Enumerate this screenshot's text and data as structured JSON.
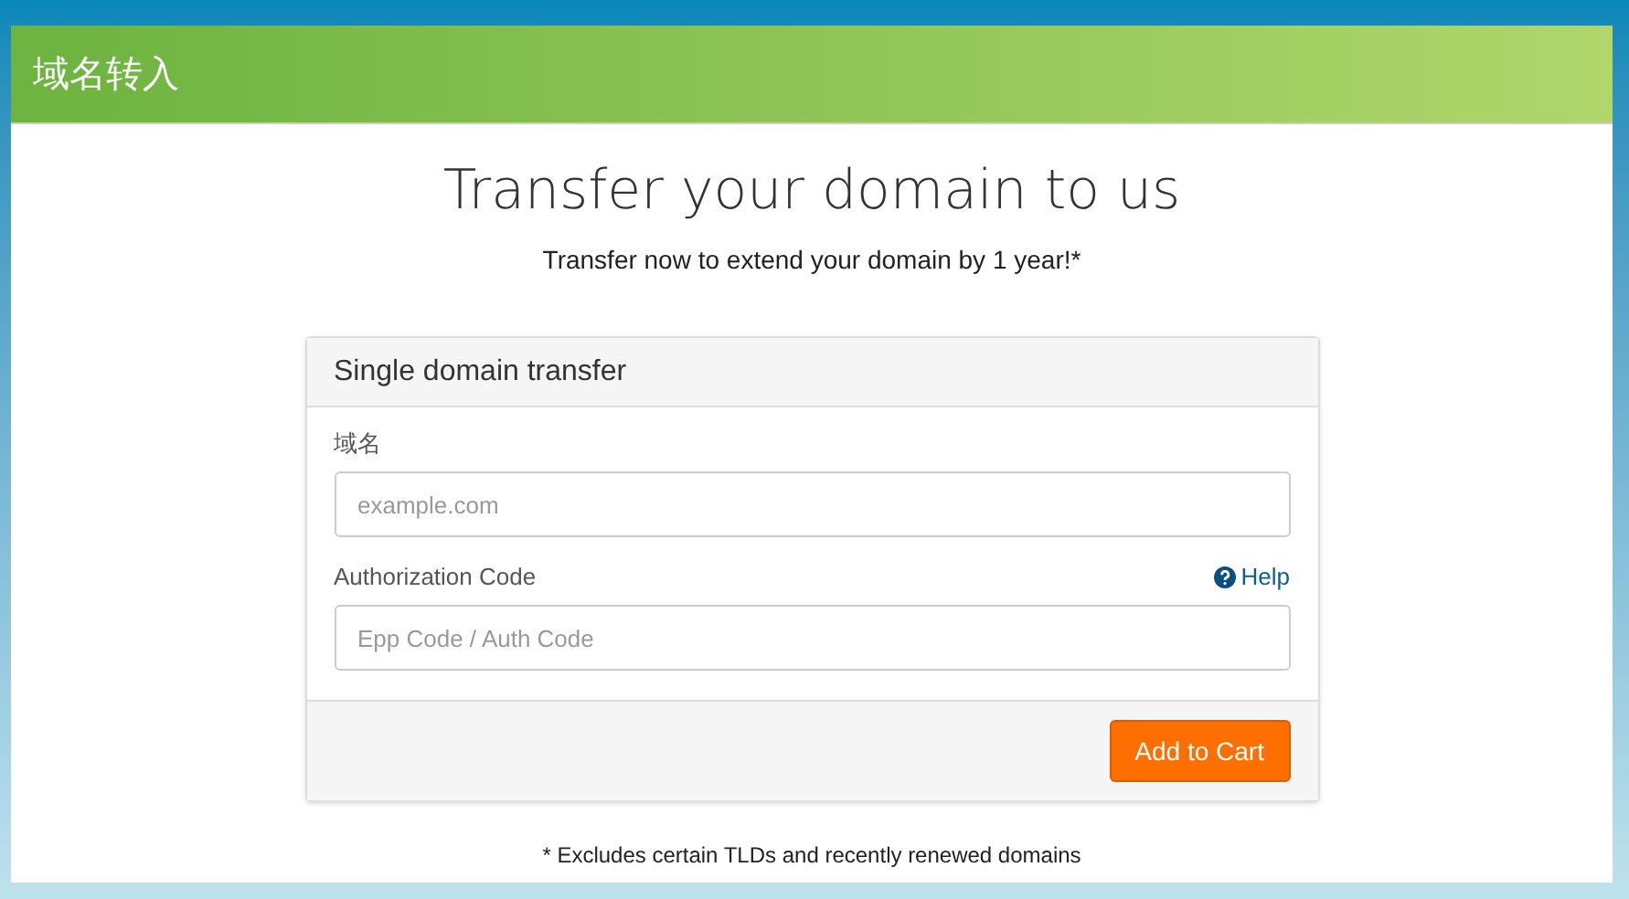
{
  "header": {
    "title": "域名转入"
  },
  "heading": "Transfer your domain to us",
  "subheading": "Transfer now to extend your domain by 1 year!*",
  "card": {
    "title": "Single domain transfer",
    "fields": [
      {
        "label": "域名",
        "placeholder": "example.com"
      },
      {
        "label": "Authorization Code",
        "placeholder": "Epp Code / Auth Code",
        "help": "Help"
      }
    ],
    "button": "Add to Cart"
  },
  "footnote": "* Excludes certain TLDs and recently renewed domains"
}
